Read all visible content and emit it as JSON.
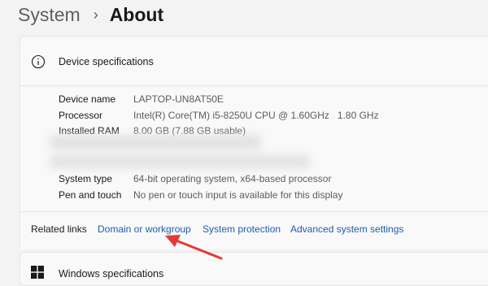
{
  "breadcrumb": {
    "parent": "System",
    "separator": "›",
    "current": "About"
  },
  "device_specs": {
    "title": "Device specifications",
    "rows": [
      {
        "label": "Device name",
        "value": "LAPTOP-UN8AT50E"
      },
      {
        "label": "Processor",
        "value": "Intel(R) Core(TM) i5-8250U CPU @ 1.60GHz   1.80 GHz"
      },
      {
        "label": "Installed RAM",
        "value": "8.00 GB (7.88 GB usable)"
      },
      {
        "label": "System type",
        "value": "64-bit operating system, x64-based processor"
      },
      {
        "label": "Pen and touch",
        "value": "No pen or touch input is available for this display"
      }
    ]
  },
  "related_links": {
    "label": "Related links",
    "links": [
      "Domain or workgroup",
      "System protection",
      "Advanced system settings"
    ]
  },
  "windows_specs": {
    "title": "Windows specifications"
  },
  "colors": {
    "link": "#1f5dab",
    "annotation_arrow": "#e53935"
  }
}
